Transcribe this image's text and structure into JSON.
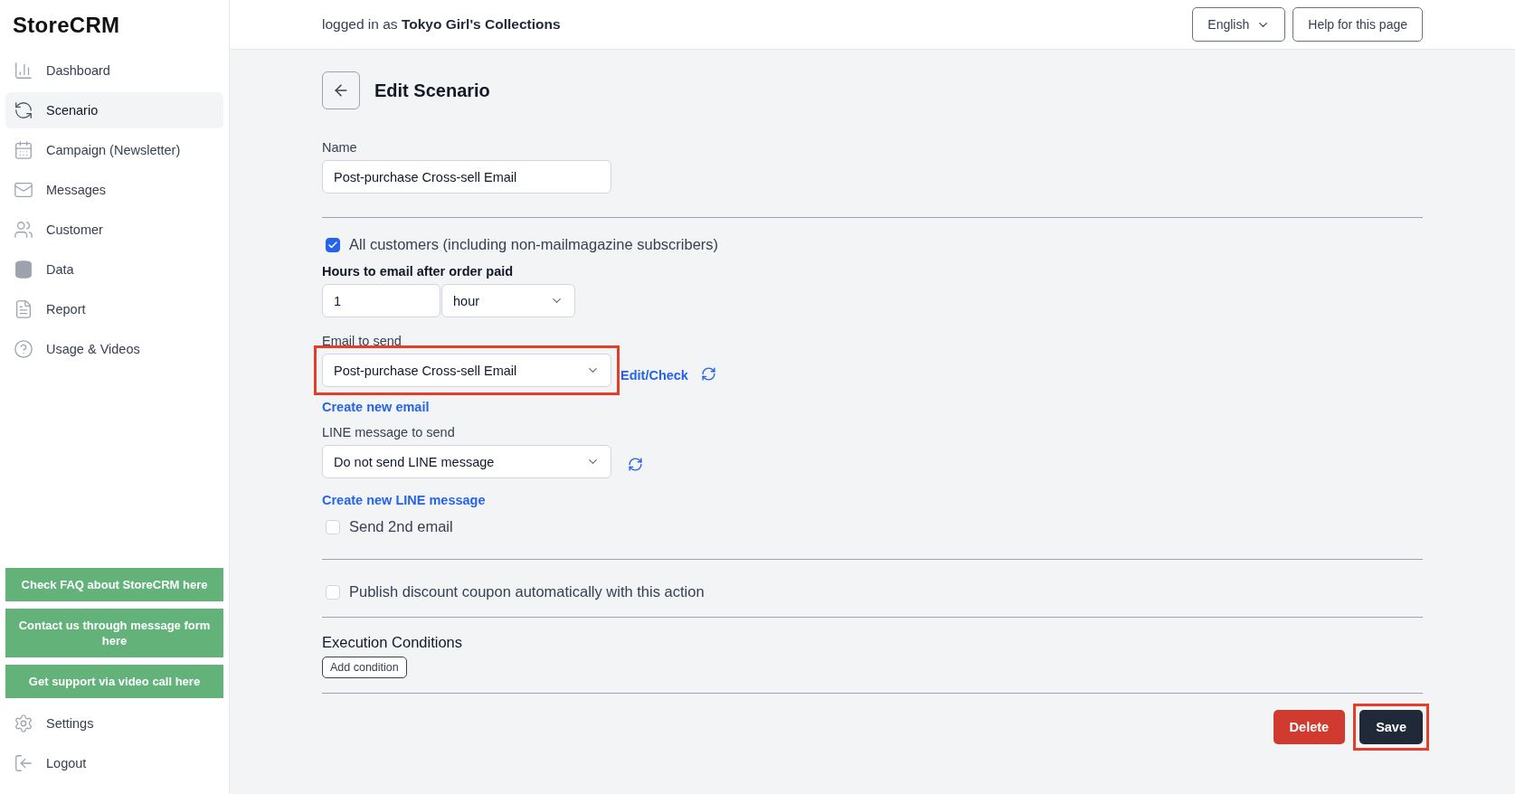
{
  "logo": "StoreCRM",
  "nav": [
    {
      "label": "Dashboard",
      "selected": false
    },
    {
      "label": "Scenario",
      "selected": true
    },
    {
      "label": "Campaign (Newsletter)",
      "selected": false
    },
    {
      "label": "Messages",
      "selected": false
    },
    {
      "label": "Customer",
      "selected": false
    },
    {
      "label": "Data",
      "selected": false
    },
    {
      "label": "Report",
      "selected": false
    },
    {
      "label": "Usage & Videos",
      "selected": false
    }
  ],
  "support_links": [
    "Check FAQ about StoreCRM here",
    "Contact us through message form here",
    "Get support via video call here"
  ],
  "bottom_nav": [
    {
      "label": "Settings"
    },
    {
      "label": "Logout"
    }
  ],
  "header": {
    "login": "logged in as **Tokyo Girl's Collections**",
    "language": "English",
    "help": "Help for this page"
  },
  "page": {
    "title": "Edit Scenario",
    "name": {
      "label": "Name",
      "value": "Post-purchase Cross-sell Email"
    },
    "all_customers": {
      "label": "All customers (including non-mailmagazine subscribers)",
      "checked": true
    },
    "hours": {
      "label": "Hours to email after order paid",
      "value": "1",
      "unit": "hour"
    },
    "email": {
      "label": "Email to send",
      "value": "Post-purchase Cross-sell Email",
      "highlighted": true,
      "edit_link": "Edit/Check",
      "create_link": "Create new email"
    },
    "line": {
      "label": "LINE message to send",
      "value": "Do not send LINE message",
      "highlighted": false,
      "create_link": "Create new LINE message"
    },
    "second_email": {
      "label": "Send 2nd email",
      "checked": false
    },
    "coupon": {
      "label": "Publish discount coupon automatically with this action",
      "checked": false
    },
    "conditions": {
      "title": "Execution Conditions",
      "button": "Add condition"
    },
    "actions": [
      {
        "kind": "danger",
        "label": "Delete",
        "highlighted": false
      },
      {
        "kind": "primary",
        "label": "Save",
        "highlighted": true
      }
    ]
  }
}
